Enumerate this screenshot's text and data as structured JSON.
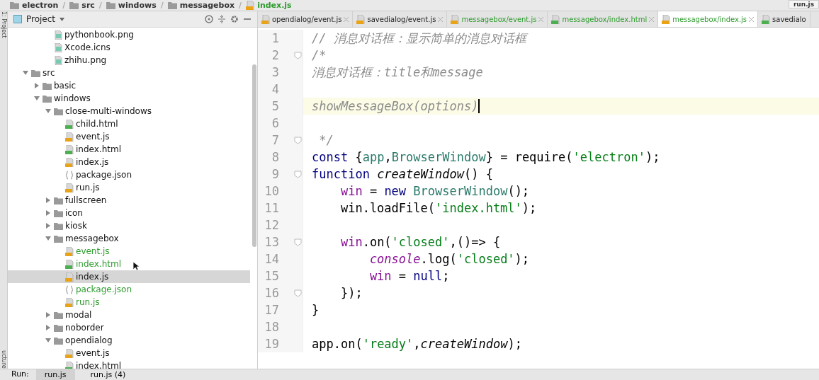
{
  "breadcrumb": [
    {
      "label": "electron",
      "kind": "folder"
    },
    {
      "sep": "/",
      "label": "src",
      "kind": "folder"
    },
    {
      "sep": "/",
      "label": "windows",
      "kind": "folder"
    },
    {
      "sep": "/",
      "label": "messagebox",
      "kind": "folder"
    },
    {
      "sep": "/",
      "label": "index.js",
      "kind": "js"
    }
  ],
  "corner_tab": {
    "label": "run.js"
  },
  "side_strip": {
    "top": "1: Project",
    "bottom": "ucture"
  },
  "project_panel": {
    "title": "Project",
    "orphans": [
      {
        "name": "pythonbook.png",
        "kind": "image",
        "selected": false
      },
      {
        "name": "Xcode.icns",
        "kind": "image",
        "selected": false
      },
      {
        "name": "zhihu.png",
        "kind": "image",
        "selected": false
      }
    ],
    "tree": [
      {
        "name": "src",
        "kind": "folder",
        "expanded": true,
        "selected": false,
        "children": [
          {
            "name": "basic",
            "kind": "folder",
            "expanded": false,
            "selected": false
          },
          {
            "name": "windows",
            "kind": "folder",
            "expanded": true,
            "selected": false,
            "children": [
              {
                "name": "close-multi-windows",
                "kind": "folder",
                "expanded": true,
                "selected": false,
                "children": [
                  {
                    "name": "child.html",
                    "kind": "html",
                    "selected": false
                  },
                  {
                    "name": "event.js",
                    "kind": "js",
                    "selected": false
                  },
                  {
                    "name": "index.html",
                    "kind": "html",
                    "selected": false
                  },
                  {
                    "name": "index.js",
                    "kind": "js",
                    "selected": false
                  },
                  {
                    "name": "package.json",
                    "kind": "json",
                    "selected": false
                  },
                  {
                    "name": "run.js",
                    "kind": "js",
                    "selected": false
                  }
                ]
              },
              {
                "name": "fullscreen",
                "kind": "folder",
                "expanded": false,
                "selected": false
              },
              {
                "name": "icon",
                "kind": "folder",
                "expanded": false,
                "selected": false
              },
              {
                "name": "kiosk",
                "kind": "folder",
                "expanded": false,
                "selected": false
              },
              {
                "name": "messagebox",
                "kind": "folder",
                "expanded": true,
                "selected": false,
                "children": [
                  {
                    "name": "event.js",
                    "kind": "js",
                    "selected": false,
                    "color": "#2e9b2e"
                  },
                  {
                    "name": "index.html",
                    "kind": "html",
                    "selected": false,
                    "color": "#2e9b2e"
                  },
                  {
                    "name": "index.js",
                    "kind": "js",
                    "selected": true
                  },
                  {
                    "name": "package.json",
                    "kind": "json",
                    "selected": false,
                    "color": "#2e9b2e"
                  },
                  {
                    "name": "run.js",
                    "kind": "js",
                    "selected": false,
                    "color": "#2e9b2e"
                  }
                ]
              },
              {
                "name": "modal",
                "kind": "folder",
                "expanded": false,
                "selected": false
              },
              {
                "name": "noborder",
                "kind": "folder",
                "expanded": false,
                "selected": false
              },
              {
                "name": "opendialog",
                "kind": "folder",
                "expanded": true,
                "selected": false,
                "children": [
                  {
                    "name": "event.js",
                    "kind": "js",
                    "selected": false
                  },
                  {
                    "name": "index.html",
                    "kind": "html",
                    "selected": false
                  }
                ]
              }
            ]
          }
        ]
      }
    ]
  },
  "editor_tabs": [
    {
      "label": "opendialog/event.js",
      "kind": "js",
      "selected": false
    },
    {
      "label": "savedialog/event.js",
      "kind": "js",
      "selected": false
    },
    {
      "label": "messagebox/event.js",
      "kind": "js",
      "selected": false,
      "color": "#2e9b2e"
    },
    {
      "label": "messagebox/index.html",
      "kind": "html",
      "selected": false,
      "color": "#2e9b2e"
    },
    {
      "label": "messagebox/index.js",
      "kind": "js",
      "selected": true,
      "color": "#2e9b2e"
    },
    {
      "label": "savedialo",
      "kind": "html",
      "selected": false
    }
  ],
  "code_lines": [
    {
      "number": "1",
      "tokens": [
        {
          "kind": "comment",
          "text": "// 消息对话框：显示简单的消息对话框"
        }
      ]
    },
    {
      "number": "2",
      "fold": true,
      "tokens": [
        {
          "kind": "comment",
          "text": "/*"
        }
      ]
    },
    {
      "number": "3",
      "tokens": [
        {
          "kind": "comment",
          "text": "消息对话框：title和message"
        }
      ]
    },
    {
      "number": "4"
    },
    {
      "number": "5",
      "current": true,
      "tokens": [
        {
          "kind": "comment",
          "text": "showMessageBox(options)"
        }
      ]
    },
    {
      "number": "6"
    },
    {
      "number": "7",
      "fold": true,
      "tokens": [
        {
          "kind": "comment",
          "text": " */"
        }
      ]
    },
    {
      "number": "8",
      "tokens": [
        {
          "kind": "keyword",
          "text": "const"
        },
        {
          "kind": "plain",
          "text": " {"
        },
        {
          "kind": "name",
          "text": "app"
        },
        {
          "kind": "plain",
          "text": ","
        },
        {
          "kind": "name",
          "text": "BrowserWindow"
        },
        {
          "kind": "plain",
          "text": "} = require("
        },
        {
          "kind": "string",
          "text": "'electron'"
        },
        {
          "kind": "plain",
          "text": ");"
        }
      ]
    },
    {
      "number": "9",
      "fold": true,
      "tokens": [
        {
          "kind": "keyword",
          "text": "function "
        },
        {
          "kind": "italic",
          "text": "createWindow"
        },
        {
          "kind": "plain",
          "text": "() {"
        }
      ]
    },
    {
      "number": "10",
      "tokens": [
        {
          "kind": "variable",
          "text": "    win"
        },
        {
          "kind": "plain",
          "text": " = "
        },
        {
          "kind": "keyword",
          "text": "new "
        },
        {
          "kind": "name",
          "text": "BrowserWindow"
        },
        {
          "kind": "plain",
          "text": "();"
        }
      ]
    },
    {
      "number": "11",
      "tokens": [
        {
          "kind": "plain",
          "text": "    win.loadFile("
        },
        {
          "kind": "string",
          "text": "'index.html'"
        },
        {
          "kind": "plain",
          "text": ");"
        }
      ]
    },
    {
      "number": "12"
    },
    {
      "number": "13",
      "fold": true,
      "tokens": [
        {
          "kind": "variable",
          "text": "    win"
        },
        {
          "kind": "plain",
          "text": ".on("
        },
        {
          "kind": "string",
          "text": "'closed'"
        },
        {
          "kind": "plain",
          "text": ",()=> {"
        }
      ]
    },
    {
      "number": "14",
      "tokens": [
        {
          "kind": "global",
          "text": "        console"
        },
        {
          "kind": "plain",
          "text": ".log("
        },
        {
          "kind": "string",
          "text": "'closed'"
        },
        {
          "kind": "plain",
          "text": ");"
        }
      ]
    },
    {
      "number": "15",
      "tokens": [
        {
          "kind": "variable",
          "text": "        win"
        },
        {
          "kind": "plain",
          "text": " = "
        },
        {
          "kind": "keyword",
          "text": "null"
        },
        {
          "kind": "plain",
          "text": ";"
        }
      ]
    },
    {
      "number": "16",
      "fold": true,
      "tokens": [
        {
          "kind": "plain",
          "text": "    });"
        }
      ]
    },
    {
      "number": "17",
      "tokens": [
        {
          "kind": "plain",
          "text": "}"
        }
      ]
    },
    {
      "number": "18"
    },
    {
      "number": "19",
      "tokens": [
        {
          "kind": "plain",
          "text": "app.on("
        },
        {
          "kind": "string",
          "text": "'ready'"
        },
        {
          "kind": "plain",
          "text": ","
        },
        {
          "kind": "italic",
          "text": "createWindow"
        },
        {
          "kind": "plain",
          "text": ");"
        }
      ]
    }
  ],
  "run_bar": {
    "label": "Run:",
    "tabs": [
      {
        "label": "run.js",
        "selected": true
      },
      {
        "label": "run.js (4)",
        "selected": false
      }
    ]
  }
}
